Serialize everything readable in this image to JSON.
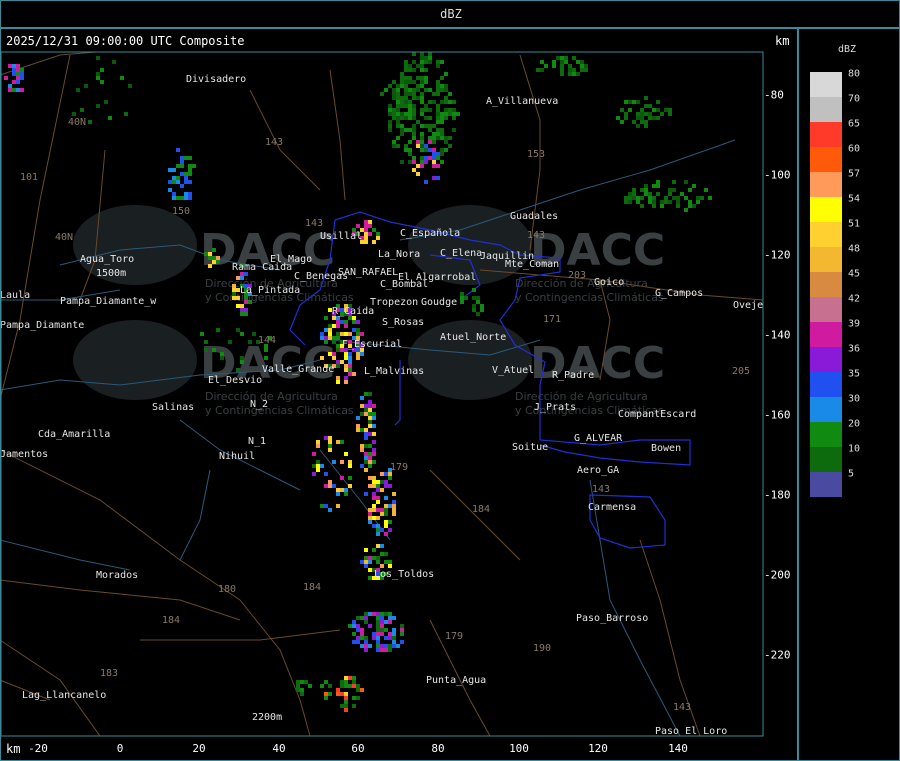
{
  "header": {
    "title": "dBZ"
  },
  "map": {
    "timestamp": "2025/12/31 09:00:00 UTC Composite",
    "unit_top": "km",
    "unit_bottom": "km",
    "x_ticks": [
      "-20",
      "0",
      "20",
      "40",
      "60",
      "80",
      "100",
      "120",
      "140"
    ],
    "y_ticks": [
      "-80",
      "-100",
      "-120",
      "-140",
      "-160",
      "-180",
      "-200",
      "-220"
    ],
    "watermark": {
      "text": "DACC",
      "subtitle_line1": "Dirección de Agricultura",
      "subtitle_line2": "y Contingencias Climáticas"
    },
    "places": [
      {
        "name": "Divisadero"
      },
      {
        "name": "A_Villanueva"
      },
      {
        "name": "Guadales"
      },
      {
        "name": "Agua_Toro"
      },
      {
        "name": "Usillal"
      },
      {
        "name": "C_Española"
      },
      {
        "name": "Rama Caida"
      },
      {
        "name": "El_Mago"
      },
      {
        "name": "C_Benegas"
      },
      {
        "name": "SAN_RAFAEL"
      },
      {
        "name": "La_Nora"
      },
      {
        "name": "C_Elena"
      },
      {
        "name": "Jaquillin"
      },
      {
        "name": "Mte_Coman"
      },
      {
        "name": "Goico"
      },
      {
        "name": "G_Campos"
      },
      {
        "name": "Ovejero"
      },
      {
        "name": "Pampa_Diamante"
      },
      {
        "name": "La_Pintada"
      },
      {
        "name": "Tropezon"
      },
      {
        "name": "Goudge"
      },
      {
        "name": "El_Algarrobal"
      },
      {
        "name": "C_Bombal"
      },
      {
        "name": "R_Caida"
      },
      {
        "name": "S_Rosas"
      },
      {
        "name": "Atuel_Norte"
      },
      {
        "name": "F_Escurial"
      },
      {
        "name": "V_Atuel"
      },
      {
        "name": "R_Padre"
      },
      {
        "name": "El_Desvio"
      },
      {
        "name": "Valle_Grande"
      },
      {
        "name": "L_Malvinas"
      },
      {
        "name": "J_Prats"
      },
      {
        "name": "CompantEscard"
      },
      {
        "name": "Salinas"
      },
      {
        "name": "N_2"
      },
      {
        "name": "Cda_Amarilla"
      },
      {
        "name": "N_1"
      },
      {
        "name": "Nihuil"
      },
      {
        "name": "G_ALVEAR"
      },
      {
        "name": "Bowen"
      },
      {
        "name": "Soitue"
      },
      {
        "name": "Aero_GA"
      },
      {
        "name": "Carmensa"
      },
      {
        "name": "Los_Toldos"
      },
      {
        "name": "Morados"
      },
      {
        "name": "Paso_Barroso"
      },
      {
        "name": "Punta_Agua"
      },
      {
        "name": "Lag_Llancanelo"
      },
      {
        "name": "Paso_El_Loro"
      },
      {
        "name": "Jamentos"
      },
      {
        "name": "Laula"
      },
      {
        "name": "Pampa_Diamante_w"
      },
      {
        "name": "1500m"
      },
      {
        "name": "2200m"
      }
    ],
    "route_numbers": [
      "101",
      "40N",
      "40N",
      "143",
      "150",
      "143",
      "153",
      "143",
      "203",
      "171",
      "144",
      "179",
      "184",
      "180",
      "179",
      "184",
      "190",
      "143",
      "183",
      "184",
      "143",
      "205"
    ]
  },
  "legend": {
    "title": "dBZ",
    "entries": [
      {
        "label": "80",
        "color": "#d8d8d8"
      },
      {
        "label": "70",
        "color": "#c0c0c0"
      },
      {
        "label": "65",
        "color": "#ff3a28"
      },
      {
        "label": "60",
        "color": "#ff5a0a"
      },
      {
        "label": "57",
        "color": "#ff9a5a"
      },
      {
        "label": "54",
        "color": "#ffff00"
      },
      {
        "label": "51",
        "color": "#ffd030"
      },
      {
        "label": "48",
        "color": "#f4b830"
      },
      {
        "label": "45",
        "color": "#d88a40"
      },
      {
        "label": "42",
        "color": "#c87090"
      },
      {
        "label": "39",
        "color": "#d01aa0"
      },
      {
        "label": "36",
        "color": "#8a1ad8"
      },
      {
        "label": "35",
        "color": "#2050f0"
      },
      {
        "label": "30",
        "color": "#1a8ae8"
      },
      {
        "label": "20",
        "color": "#118a11"
      },
      {
        "label": "10",
        "color": "#0d6a0d"
      },
      {
        "label": "5",
        "color": "#4a4aa0"
      }
    ]
  }
}
